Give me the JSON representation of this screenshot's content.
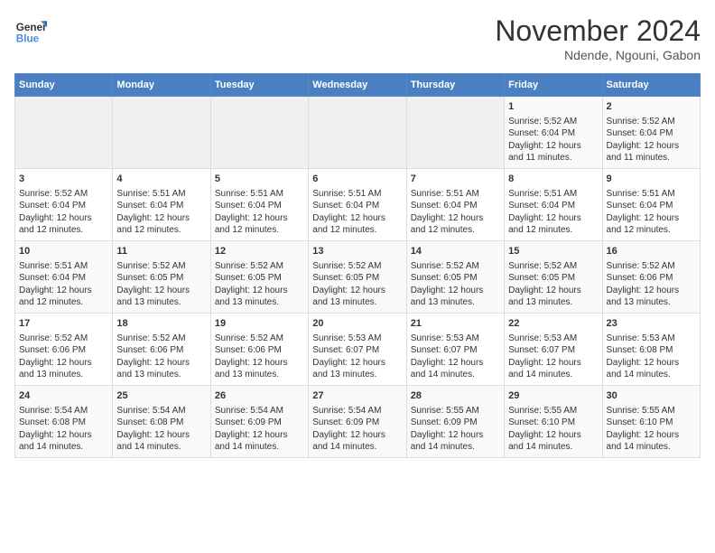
{
  "header": {
    "logo_line1": "General",
    "logo_line2": "Blue",
    "title": "November 2024",
    "subtitle": "Ndende, Ngouni, Gabon"
  },
  "weekdays": [
    "Sunday",
    "Monday",
    "Tuesday",
    "Wednesday",
    "Thursday",
    "Friday",
    "Saturday"
  ],
  "weeks": [
    [
      {
        "day": "",
        "empty": true
      },
      {
        "day": "",
        "empty": true
      },
      {
        "day": "",
        "empty": true
      },
      {
        "day": "",
        "empty": true
      },
      {
        "day": "",
        "empty": true
      },
      {
        "day": "1",
        "sunrise": "5:52 AM",
        "sunset": "6:04 PM",
        "daylight": "12 hours and 11 minutes."
      },
      {
        "day": "2",
        "sunrise": "5:52 AM",
        "sunset": "6:04 PM",
        "daylight": "12 hours and 11 minutes."
      }
    ],
    [
      {
        "day": "3",
        "sunrise": "5:52 AM",
        "sunset": "6:04 PM",
        "daylight": "12 hours and 12 minutes."
      },
      {
        "day": "4",
        "sunrise": "5:51 AM",
        "sunset": "6:04 PM",
        "daylight": "12 hours and 12 minutes."
      },
      {
        "day": "5",
        "sunrise": "5:51 AM",
        "sunset": "6:04 PM",
        "daylight": "12 hours and 12 minutes."
      },
      {
        "day": "6",
        "sunrise": "5:51 AM",
        "sunset": "6:04 PM",
        "daylight": "12 hours and 12 minutes."
      },
      {
        "day": "7",
        "sunrise": "5:51 AM",
        "sunset": "6:04 PM",
        "daylight": "12 hours and 12 minutes."
      },
      {
        "day": "8",
        "sunrise": "5:51 AM",
        "sunset": "6:04 PM",
        "daylight": "12 hours and 12 minutes."
      },
      {
        "day": "9",
        "sunrise": "5:51 AM",
        "sunset": "6:04 PM",
        "daylight": "12 hours and 12 minutes."
      }
    ],
    [
      {
        "day": "10",
        "sunrise": "5:51 AM",
        "sunset": "6:04 PM",
        "daylight": "12 hours and 12 minutes."
      },
      {
        "day": "11",
        "sunrise": "5:52 AM",
        "sunset": "6:05 PM",
        "daylight": "12 hours and 13 minutes."
      },
      {
        "day": "12",
        "sunrise": "5:52 AM",
        "sunset": "6:05 PM",
        "daylight": "12 hours and 13 minutes."
      },
      {
        "day": "13",
        "sunrise": "5:52 AM",
        "sunset": "6:05 PM",
        "daylight": "12 hours and 13 minutes."
      },
      {
        "day": "14",
        "sunrise": "5:52 AM",
        "sunset": "6:05 PM",
        "daylight": "12 hours and 13 minutes."
      },
      {
        "day": "15",
        "sunrise": "5:52 AM",
        "sunset": "6:05 PM",
        "daylight": "12 hours and 13 minutes."
      },
      {
        "day": "16",
        "sunrise": "5:52 AM",
        "sunset": "6:06 PM",
        "daylight": "12 hours and 13 minutes."
      }
    ],
    [
      {
        "day": "17",
        "sunrise": "5:52 AM",
        "sunset": "6:06 PM",
        "daylight": "12 hours and 13 minutes."
      },
      {
        "day": "18",
        "sunrise": "5:52 AM",
        "sunset": "6:06 PM",
        "daylight": "12 hours and 13 minutes."
      },
      {
        "day": "19",
        "sunrise": "5:52 AM",
        "sunset": "6:06 PM",
        "daylight": "12 hours and 13 minutes."
      },
      {
        "day": "20",
        "sunrise": "5:53 AM",
        "sunset": "6:07 PM",
        "daylight": "12 hours and 13 minutes."
      },
      {
        "day": "21",
        "sunrise": "5:53 AM",
        "sunset": "6:07 PM",
        "daylight": "12 hours and 14 minutes."
      },
      {
        "day": "22",
        "sunrise": "5:53 AM",
        "sunset": "6:07 PM",
        "daylight": "12 hours and 14 minutes."
      },
      {
        "day": "23",
        "sunrise": "5:53 AM",
        "sunset": "6:08 PM",
        "daylight": "12 hours and 14 minutes."
      }
    ],
    [
      {
        "day": "24",
        "sunrise": "5:54 AM",
        "sunset": "6:08 PM",
        "daylight": "12 hours and 14 minutes."
      },
      {
        "day": "25",
        "sunrise": "5:54 AM",
        "sunset": "6:08 PM",
        "daylight": "12 hours and 14 minutes."
      },
      {
        "day": "26",
        "sunrise": "5:54 AM",
        "sunset": "6:09 PM",
        "daylight": "12 hours and 14 minutes."
      },
      {
        "day": "27",
        "sunrise": "5:54 AM",
        "sunset": "6:09 PM",
        "daylight": "12 hours and 14 minutes."
      },
      {
        "day": "28",
        "sunrise": "5:55 AM",
        "sunset": "6:09 PM",
        "daylight": "12 hours and 14 minutes."
      },
      {
        "day": "29",
        "sunrise": "5:55 AM",
        "sunset": "6:10 PM",
        "daylight": "12 hours and 14 minutes."
      },
      {
        "day": "30",
        "sunrise": "5:55 AM",
        "sunset": "6:10 PM",
        "daylight": "12 hours and 14 minutes."
      }
    ]
  ]
}
